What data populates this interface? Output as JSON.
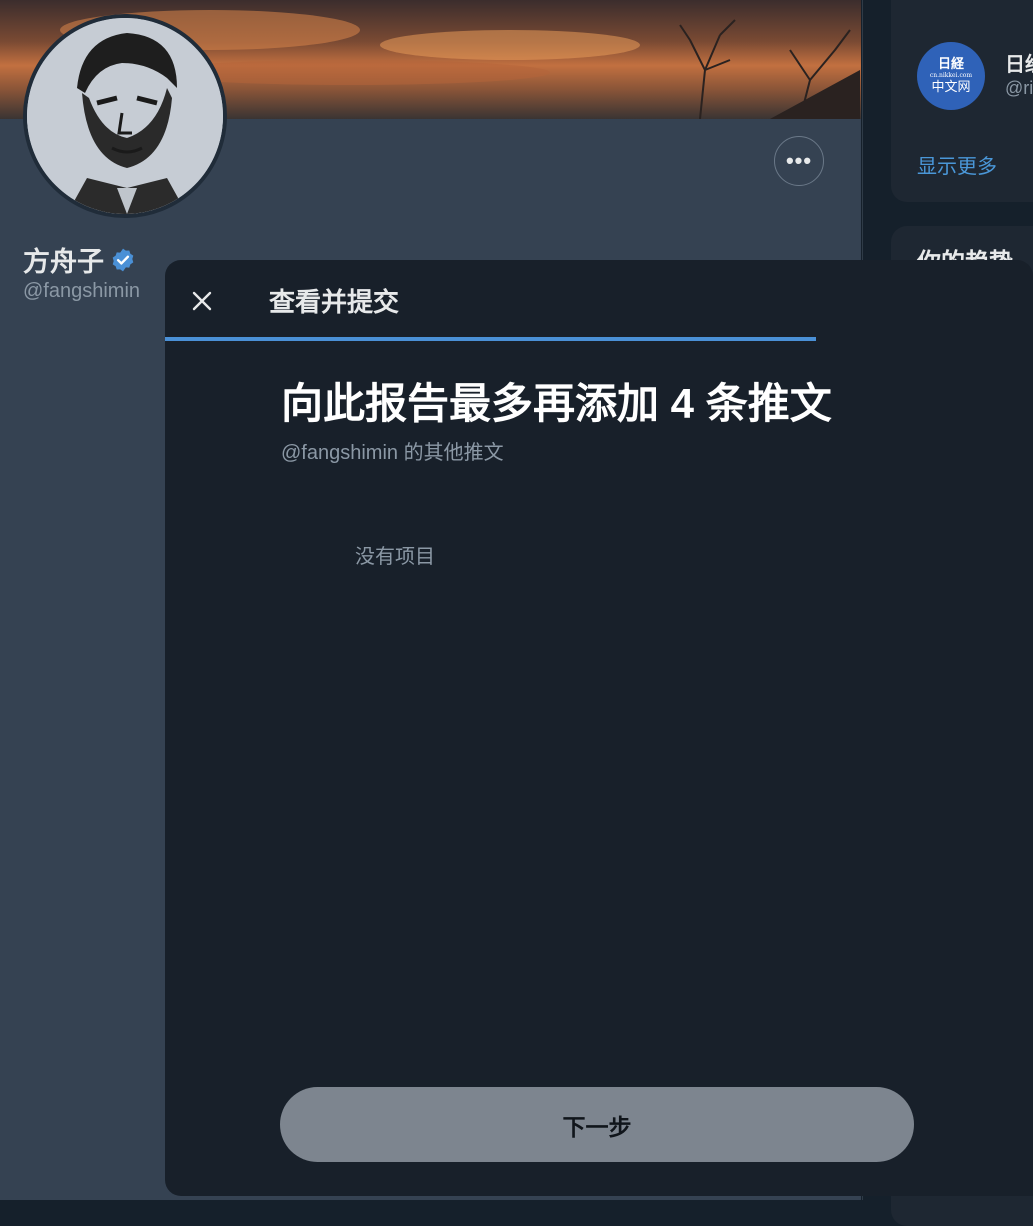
{
  "profile": {
    "name": "方舟子",
    "handle": "@fangshimin",
    "more_icon": "more-horizontal-icon",
    "verified_icon": "verified-badge-icon"
  },
  "sidebar": {
    "who_to_follow": {
      "item": {
        "logo_text_top": "日経",
        "logo_text_mid": "cn.nikkei.com",
        "logo_text_bottom": "中文网",
        "name": "日经",
        "handle": "@ri"
      },
      "show_more": "显示更多"
    },
    "trends": {
      "title": "你的趋势"
    }
  },
  "modal": {
    "title": "查看并提交",
    "close_icon": "close-icon",
    "progress_fraction": 0.75,
    "heading": "向此报告最多再添加 4 条推文",
    "subheading": "@fangshimin 的其他推文",
    "empty_text": "没有项目",
    "next_button": "下一步"
  },
  "colors": {
    "accent": "#4a90d6",
    "modal_bg": "#18202a",
    "page_bg": "#354252",
    "button_disabled": "#7d858f"
  }
}
